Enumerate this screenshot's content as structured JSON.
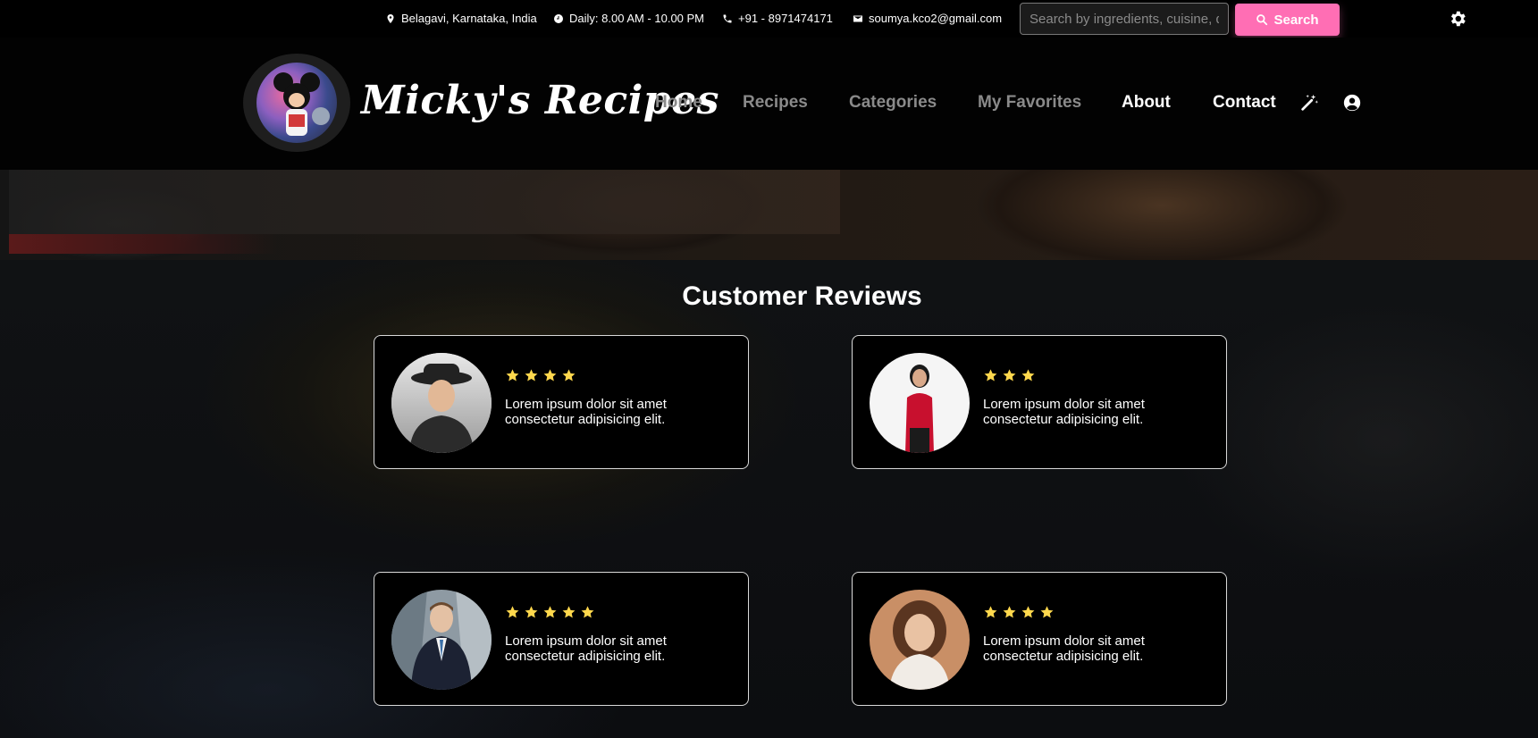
{
  "topbar": {
    "location": "Belagavi, Karnataka, India",
    "hours": "Daily: 8.00 AM - 10.00 PM",
    "phone": "+91 - 8971474171",
    "email": "soumya.kco2@gmail.com",
    "search_placeholder": "Search by ingredients, cuisine, dish...",
    "search_label": "Search"
  },
  "brand": {
    "name": "Micky's Recipes"
  },
  "nav": {
    "home": "Home",
    "recipes": "Recipes",
    "categories": "Categories",
    "favorites": "My Favorites",
    "about": "About",
    "contact": "Contact"
  },
  "colors": {
    "accent": "#ff6eb4",
    "star": "#ffd84d"
  },
  "reviews": {
    "title": "Customer Reviews",
    "items": [
      {
        "rating": 4,
        "text": "Lorem ipsum dolor sit amet consectetur adipisicing elit."
      },
      {
        "rating": 3,
        "text": "Lorem ipsum dolor sit amet consectetur adipisicing elit."
      },
      {
        "rating": 5,
        "text": "Lorem ipsum dolor sit amet consectetur adipisicing elit."
      },
      {
        "rating": 4,
        "text": "Lorem ipsum dolor sit amet consectetur adipisicing elit."
      }
    ]
  }
}
